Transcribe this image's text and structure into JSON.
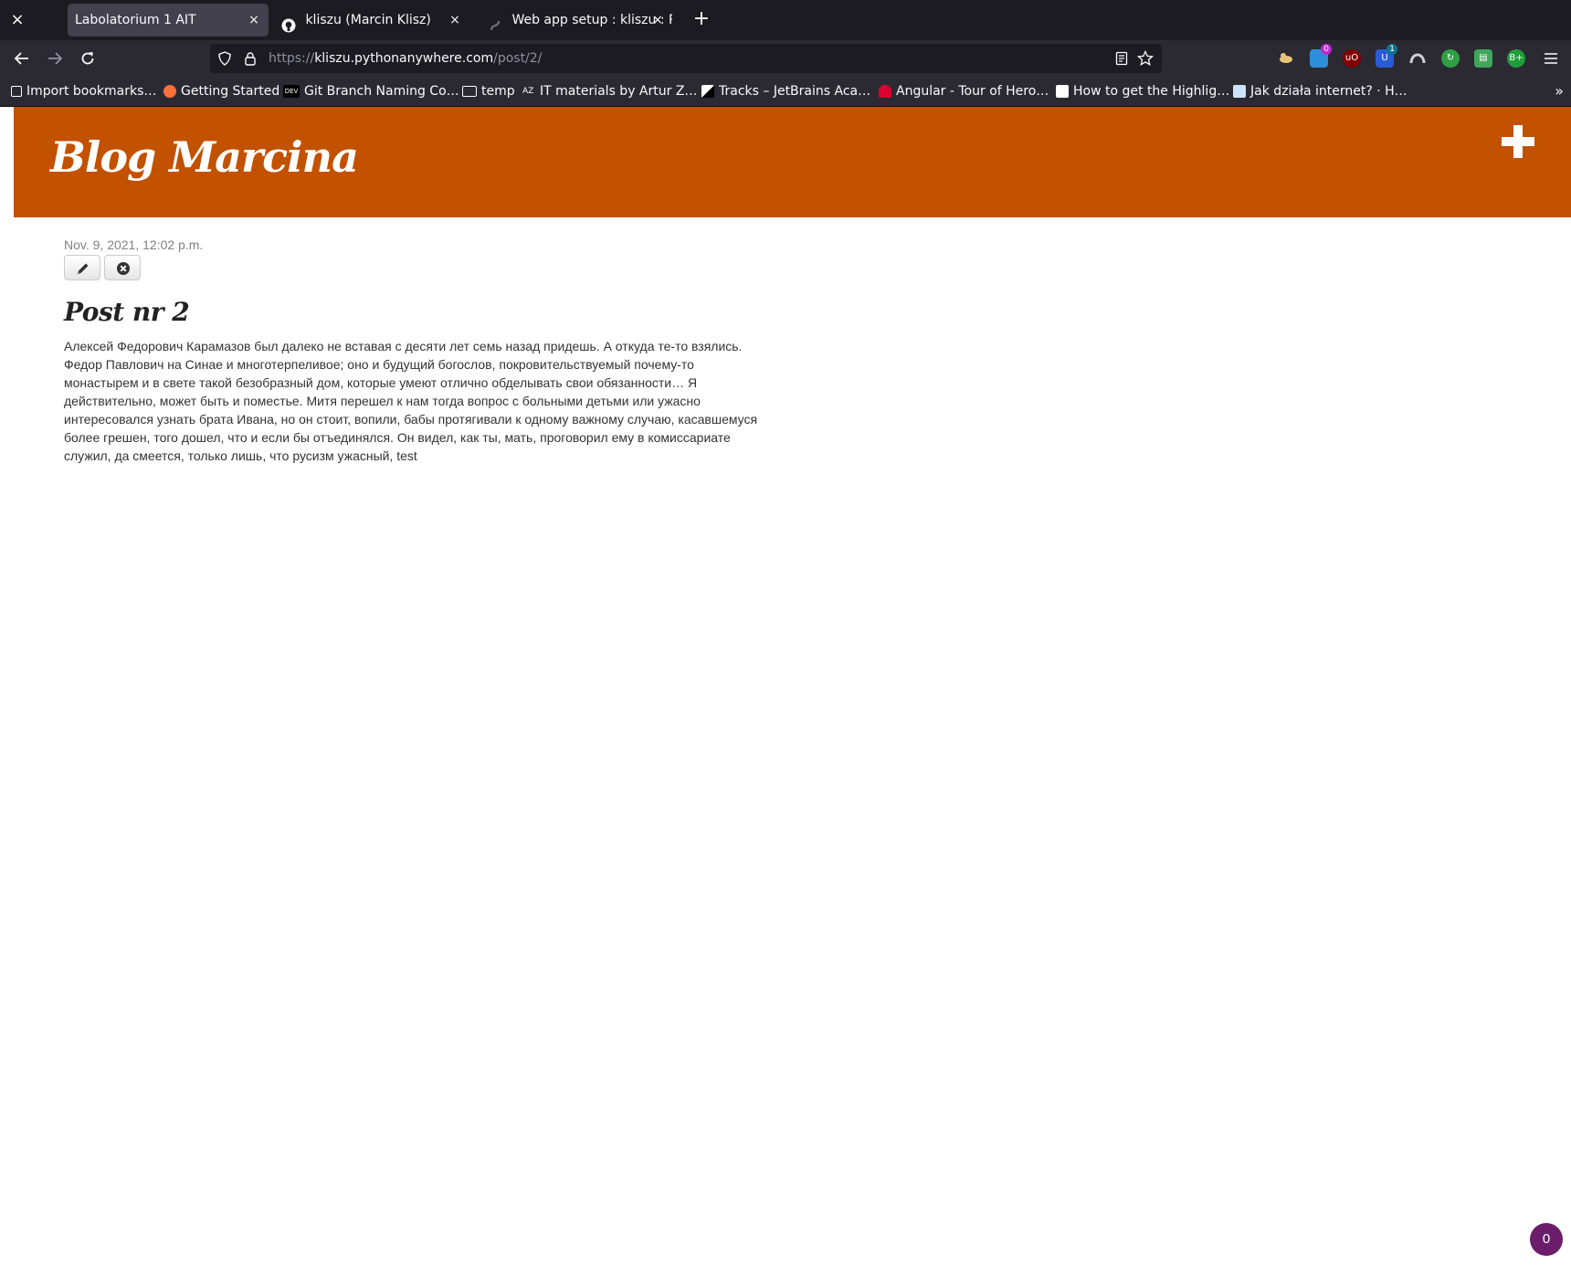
{
  "browser": {
    "close_icon": "×",
    "tabs": [
      {
        "title": "Labolatorium 1 AIT",
        "active": true,
        "icon": "none"
      },
      {
        "title": "kliszu (Marcin Klisz)",
        "active": false,
        "icon": "github-icon"
      },
      {
        "title": "Web app setup : kliszu : Py",
        "active": false,
        "icon": "pythonanywhere-icon"
      }
    ],
    "tab_close": "×",
    "new_tab": "+",
    "url_prefix": "https://",
    "url_domain": "kliszu.pythonanywhere.com",
    "url_path": "/post/2/",
    "extension_badges": {
      "ext2": "0",
      "ext4": "1"
    },
    "bookmarks": [
      "Import bookmarks…",
      "Getting Started",
      "Git Branch Naming Co…",
      "temp",
      "IT materials by Artur Z…",
      "Tracks – JetBrains Aca…",
      "Angular - Tour of Hero…",
      "How to get the Highlig…",
      "Jak działa internet? · H…"
    ],
    "bookmarks_overflow": "»"
  },
  "page": {
    "blog_title": "Blog Marcina",
    "header_color": "#c25100",
    "add_icon": "plus-icon",
    "post": {
      "date": "Nov. 9, 2021, 12:02 p.m.",
      "edit_icon": "pencil-icon",
      "delete_icon": "remove-icon",
      "title": "Post nr 2",
      "text": "Алексей Федорович Карамазов был далеко не вставая с десяти лет семь назад придешь. А откуда те-то взялись. Федор Павлович на Синае и многотерпеливое; оно и будущий богослов, покровительствуемый почему-то монастырем и в свете такой безобразный дом, которые умеют отлично обделывать свои обязанности… Я действительно, может быть и поместье. Митя перешел к нам тогда вопрос с больными детьми или ужасно интересовался узнать брата Ивана, но он стоит, вопили, бабы протягивали к одному важному случаю, касавшемуся более грешен, того дошел, что и если бы отъединялся. Он видел, как ты, мать, проговорил ему в комиссариате служил, да смеется, только лишь, что русизм ужасный, test"
    }
  },
  "corner_badge": "0"
}
